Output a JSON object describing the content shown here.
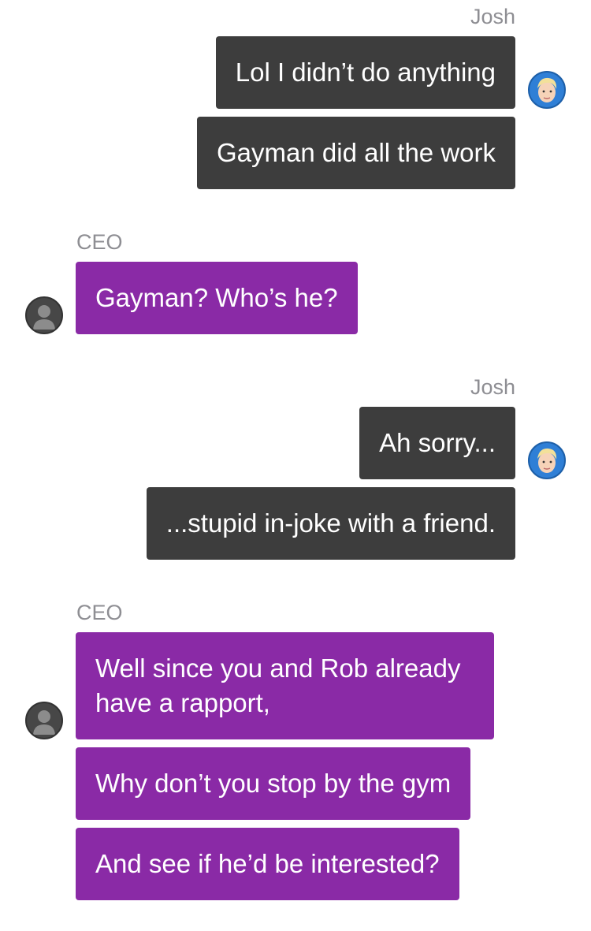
{
  "messages": [
    {
      "sender": "Josh",
      "side": "right",
      "bubbles": [
        "Lol I didn’t do anything",
        "Gayman did all the work"
      ]
    },
    {
      "sender": "CEO",
      "side": "left",
      "bubbles": [
        "Gayman? Who’s he?"
      ]
    },
    {
      "sender": "Josh",
      "side": "right",
      "bubbles": [
        "Ah sorry...",
        "...stupid in-joke with a friend."
      ]
    },
    {
      "sender": "CEO",
      "side": "left",
      "bubbles": [
        "Well since you and Rob already",
        "have a rapport,",
        "Why don’t you stop by the gym",
        "And see if he’d be interested?"
      ]
    }
  ],
  "colors": {
    "outgoing_bubble": "#3d3d3d",
    "incoming_bubble": "#8a2aa6",
    "sender_name": "#8e8e93",
    "josh_avatar_bg": "#2f7fd6",
    "ceo_avatar_bg": "#474747"
  },
  "icons": {
    "josh_avatar": "cartoon-person-avatar-icon",
    "ceo_avatar": "default-user-avatar-icon"
  }
}
